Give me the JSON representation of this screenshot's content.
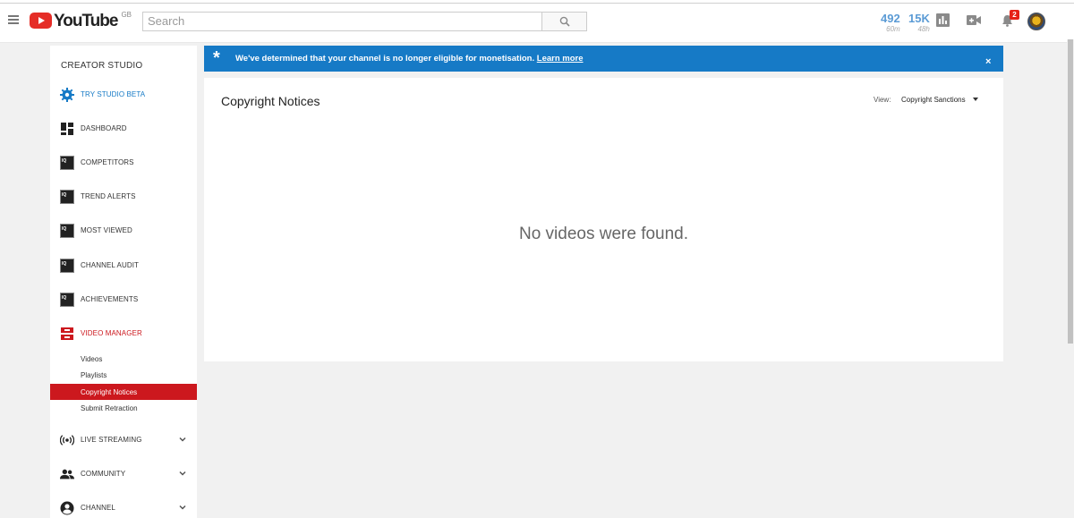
{
  "header": {
    "logo_text": "YouTube",
    "region": "GB",
    "search_placeholder": "Search",
    "stats": [
      {
        "value": "492",
        "period": "60m"
      },
      {
        "value": "15K",
        "period": "48h"
      }
    ],
    "notification_count": "2"
  },
  "sidebar": {
    "title": "CREATOR STUDIO",
    "items": [
      {
        "label": "TRY STUDIO BETA",
        "icon": "gear-icon"
      },
      {
        "label": "DASHBOARD",
        "icon": "dashboard-icon"
      },
      {
        "label": "COMPETITORS",
        "icon": "vidiq-icon"
      },
      {
        "label": "TREND ALERTS",
        "icon": "vidiq-icon"
      },
      {
        "label": "MOST VIEWED",
        "icon": "vidiq-icon"
      },
      {
        "label": "CHANNEL AUDIT",
        "icon": "vidiq-icon"
      },
      {
        "label": "ACHIEVEMENTS",
        "icon": "vidiq-icon"
      },
      {
        "label": "VIDEO MANAGER",
        "icon": "video-manager-icon"
      },
      {
        "label": "LIVE STREAMING",
        "icon": "live-icon"
      },
      {
        "label": "COMMUNITY",
        "icon": "community-icon"
      },
      {
        "label": "CHANNEL",
        "icon": "account-icon"
      }
    ],
    "video_manager_sub": [
      {
        "label": "Videos"
      },
      {
        "label": "Playlists"
      },
      {
        "label": "Copyright Notices"
      },
      {
        "label": "Submit Retraction"
      }
    ]
  },
  "banner": {
    "message": "We've determined that your channel is no longer eligible for monetisation.",
    "link": "Learn more",
    "close": "×"
  },
  "main": {
    "title": "Copyright Notices",
    "view_label": "View:",
    "view_value": "Copyright Sanctions",
    "empty_message": "No videos were found."
  },
  "colors": {
    "brand_red": "#e52d27",
    "active_red": "#cc181e",
    "banner_blue": "#167ac6",
    "beta_blue": "#167ac6"
  }
}
